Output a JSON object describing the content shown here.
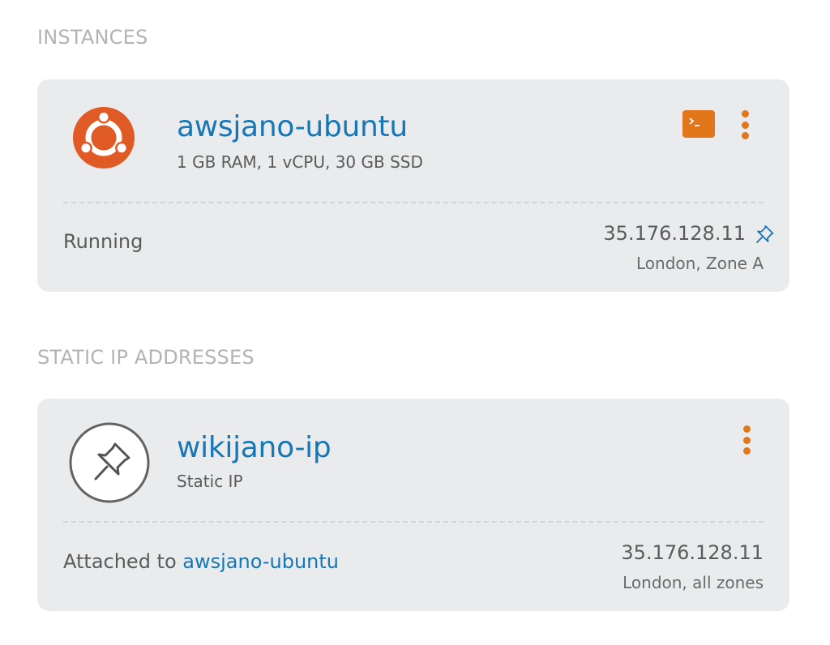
{
  "instances": {
    "section_title": "INSTANCES",
    "card": {
      "icon": "ubuntu-logo-icon",
      "name": "awsjano-ubuntu",
      "specs": "1 GB RAM, 1 vCPU, 30 GB SSD",
      "status": "Running",
      "ip": "35.176.128.11",
      "location": "London, Zone A",
      "actions": [
        "terminal-icon",
        "kebab-menu-icon"
      ],
      "ip_icon": "pin-icon"
    }
  },
  "static_ips": {
    "section_title": "STATIC IP ADDRESSES",
    "card": {
      "icon": "pin-circle-icon",
      "name": "wikijano-ip",
      "type": "Static IP",
      "attached_label": "Attached to",
      "attached_to": "awsjano-ubuntu",
      "ip": "35.176.128.11",
      "location": "London, all zones",
      "actions": [
        "kebab-menu-icon"
      ]
    }
  },
  "colors": {
    "accent_orange": "#e2761b",
    "ubuntu_orange": "#e05a26",
    "link_blue": "#1677b6",
    "card_bg": "#e9ebec",
    "section_gray": "#b3b3b3"
  }
}
